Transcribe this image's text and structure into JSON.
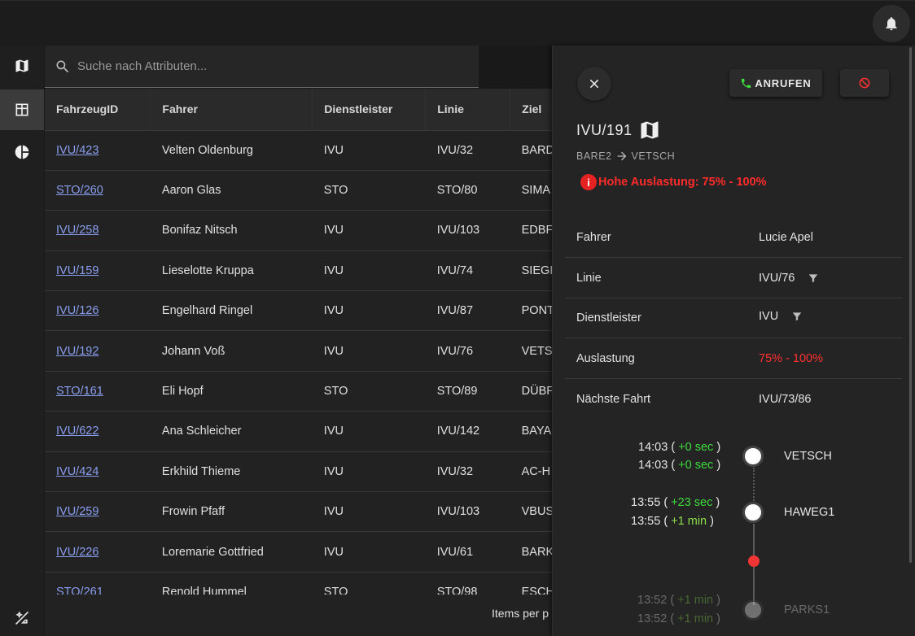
{
  "search": {
    "placeholder": "Suche nach Attributen..."
  },
  "table": {
    "columns": [
      "FahrzeugID",
      "Fahrer",
      "Dienstleister",
      "Linie",
      "Ziel"
    ],
    "rows": [
      {
        "id": "IVU/423",
        "driver": "Velten Oldenburg",
        "provider": "IVU",
        "line": "IVU/32",
        "dest": "BARD"
      },
      {
        "id": "STO/260",
        "driver": "Aaron Glas",
        "provider": "STO",
        "line": "STO/80",
        "dest": "SIMA"
      },
      {
        "id": "IVU/258",
        "driver": "Bonifaz Nitsch",
        "provider": "IVU",
        "line": "IVU/103",
        "dest": "EDBF"
      },
      {
        "id": "IVU/159",
        "driver": "Lieselotte Kruppa",
        "provider": "IVU",
        "line": "IVU/74",
        "dest": "SIEGI"
      },
      {
        "id": "IVU/126",
        "driver": "Engelhard Ringel",
        "provider": "IVU",
        "line": "IVU/87",
        "dest": "PONT"
      },
      {
        "id": "IVU/192",
        "driver": "Johann Voß",
        "provider": "IVU",
        "line": "IVU/76",
        "dest": "VETS"
      },
      {
        "id": "STO/161",
        "driver": "Eli Hopf",
        "provider": "STO",
        "line": "STO/89",
        "dest": "DÜBF"
      },
      {
        "id": "IVU/622",
        "driver": "Ana Schleicher",
        "provider": "IVU",
        "line": "IVU/142",
        "dest": "BAYA"
      },
      {
        "id": "IVU/424",
        "driver": "Erkhild Thieme",
        "provider": "IVU",
        "line": "IVU/32",
        "dest": "AC-H"
      },
      {
        "id": "IVU/259",
        "driver": "Frowin Pfaff",
        "provider": "IVU",
        "line": "IVU/103",
        "dest": "VBUS"
      },
      {
        "id": "IVU/226",
        "driver": "Loremarie Gottfried",
        "provider": "IVU",
        "line": "IVU/61",
        "dest": "BARK"
      },
      {
        "id": "STO/261",
        "driver": "Renold Hummel",
        "provider": "STO",
        "line": "STO/98",
        "dest": "ESCH"
      }
    ]
  },
  "footer": {
    "items_per_page": "Items per p"
  },
  "panel": {
    "call_label": "ANRUFEN",
    "vehicle_id": "IVU/191",
    "route_from": "BARE2",
    "route_to": "VETSCH",
    "warning": "Hohe Auslastung: 75% - 100%",
    "attributes": [
      {
        "key": "Fahrer",
        "value": "Lucie Apel"
      },
      {
        "key": "Linie",
        "value": "IVU/76"
      },
      {
        "key": "Dienstleister",
        "value": "IVU"
      },
      {
        "key": "Auslastung",
        "value": "75% - 100%"
      },
      {
        "key": "Nächste Fahrt",
        "value": "IVU/73/86"
      }
    ],
    "timeline": [
      {
        "stop": "VETSCH",
        "t1": "14:03",
        "d1": "+0 sec",
        "t2": "14:03",
        "d2": "+0 sec"
      },
      {
        "stop": "HAWEG1",
        "t1": "13:55",
        "d1": "+23 sec",
        "t2": "13:55",
        "d2": "+1 min"
      },
      {
        "stop": "PARKS1",
        "t1": "13:52",
        "d1": "+1 min",
        "t2": "13:52",
        "d2": "+1 min"
      }
    ]
  },
  "colors": {
    "accent_red": "#ff2b2b",
    "link": "#8a9ef0",
    "delay_green": "#3ddc3d"
  },
  "icons": {
    "notifications": "bell-icon",
    "map": "map-icon",
    "table": "table-icon",
    "chart": "pie-chart-icon",
    "theme": "theme-toggle-icon"
  }
}
